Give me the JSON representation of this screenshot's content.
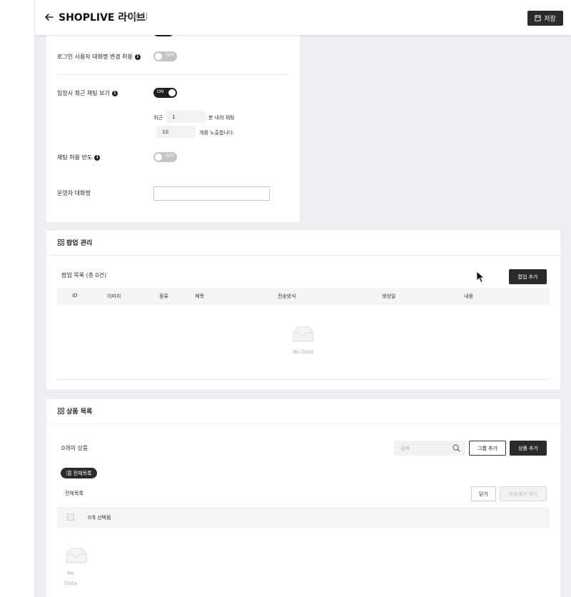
{
  "header": {
    "title": "SHOPLIVE 라이브",
    "page_id": "[807]",
    "save_label": "저장"
  },
  "settings": {
    "login_name_change": {
      "label": "로그인 사용자 대화명 변경 허용",
      "toggle": "OFF"
    },
    "recent_chat": {
      "label": "입장시 최근 채팅 보기",
      "toggle": "ON"
    },
    "recent_prefix": "최근",
    "recent_minutes": "1",
    "recent_minutes_suffix": "분 내의 채팅",
    "recent_count": "10",
    "recent_count_suffix": "개를 노출합니다.",
    "chat_frequency": {
      "label": "채팅 허용 빈도",
      "toggle": "OFF"
    },
    "operator_name": {
      "label": "운영자 대화명",
      "value": ""
    }
  },
  "popup": {
    "title": "팝업 관리",
    "list_count": "팝업 목록 (총 0건)",
    "add_label": "팝업 추가",
    "columns": [
      "ID",
      "이미지",
      "종류",
      "제목",
      "전송방식",
      "생성일",
      "내용"
    ],
    "empty_text": "No Data"
  },
  "products": {
    "title": "상품 목록",
    "count_text": "0개의 상품",
    "search_placeholder": "검색",
    "group_add_label": "그룹 추가",
    "product_add_label": "상품 추가",
    "all_list_pill": "전체목록",
    "all_list_label": "전체목록",
    "close_label": "닫기",
    "remove_label": "방송에서 제거",
    "selected_text": "0개 선택됨",
    "empty_text_1": "No",
    "empty_text_2": "Data"
  },
  "colors": {
    "dark": "#2b2b2b",
    "background": "#eceef1",
    "toggle_off": "#c4c4c4"
  }
}
